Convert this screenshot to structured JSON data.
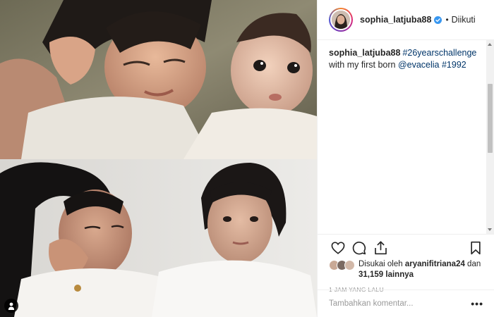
{
  "header": {
    "username": "sophia_latjuba88",
    "separator": "•",
    "follow_state": "Diikuti"
  },
  "caption": {
    "username": "sophia_latjuba88",
    "hashtag_challenge": "#26yearschallenge",
    "text_middle": " with my first born ",
    "mention": "@evacelia",
    "hashtag_year": "#1992"
  },
  "actions": {
    "icons": [
      "heart-icon",
      "comment-icon",
      "share-icon",
      "bookmark-icon"
    ]
  },
  "likes": {
    "liked_by_prefix": "Disukai oleh ",
    "liked_by_user": "aryanifitriana24",
    "connector": " dan ",
    "others_count": "31,159",
    "others_suffix": " lainnya"
  },
  "timestamp": "1 JAM YANG LALU",
  "comment": {
    "placeholder": "Tambahkan komentar...",
    "more_label": "•••"
  },
  "colors": {
    "link": "#003569",
    "text": "#262626",
    "muted": "#999999",
    "border": "#efefef"
  }
}
